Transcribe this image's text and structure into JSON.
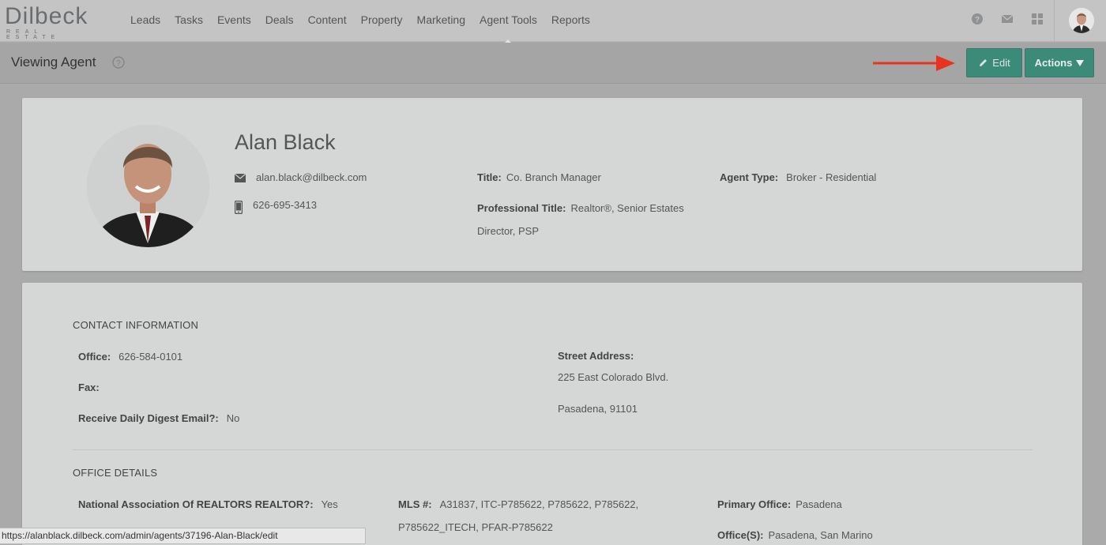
{
  "logo": {
    "word": "Dilbeck",
    "sub": "REAL ESTATE"
  },
  "nav": {
    "items": [
      "Leads",
      "Tasks",
      "Events",
      "Deals",
      "Content",
      "Property",
      "Marketing",
      "Agent Tools",
      "Reports"
    ],
    "active": "Agent Tools",
    "icons": [
      "help-icon",
      "mail-icon",
      "grid-icon"
    ]
  },
  "header": {
    "title": "Viewing Agent",
    "edit_label": "Edit",
    "actions_label": "Actions"
  },
  "agent": {
    "name": "Alan Black",
    "email": "alan.black@dilbeck.com",
    "phone": "626-695-3413",
    "title_label": "Title:",
    "title": "Co. Branch Manager",
    "agent_type_label": "Agent Type:",
    "agent_type": "Broker - Residential",
    "professional_title_label": "Professional Title:",
    "professional_title_line1": "Realtor®, Senior Estates",
    "professional_title_line2": "Director, PSP"
  },
  "contact": {
    "section_title": "CONTACT INFORMATION",
    "office_label": "Office:",
    "office": "626-584-0101",
    "fax_label": "Fax:",
    "digest_label": "Receive Daily Digest Email?:",
    "digest": "No",
    "street_label": "Street Address:",
    "street_line1": "225 East Colorado Blvd.",
    "street_line2": "Pasadena, 91101"
  },
  "office_details": {
    "section_title": "OFFICE DETAILS",
    "nar_label": "National Association Of REALTORS REALTOR?:",
    "nar": "Yes",
    "mls_label": "MLS #:",
    "mls_line1": "A31837, ITC-P785622, P785622, P785622,",
    "mls_line2": "P785622_ITECH, PFAR-P785622",
    "primary_office_label": "Primary Office:",
    "primary_office": "Pasadena",
    "offices_label": "Office(S):",
    "offices": "Pasadena, San Marino"
  },
  "statusbar": {
    "url": "https://alanblack.dilbeck.com/admin/agents/37196-Alan-Black/edit"
  },
  "colors": {
    "accent": "#3c8a78",
    "arrow": "#e8331f"
  }
}
